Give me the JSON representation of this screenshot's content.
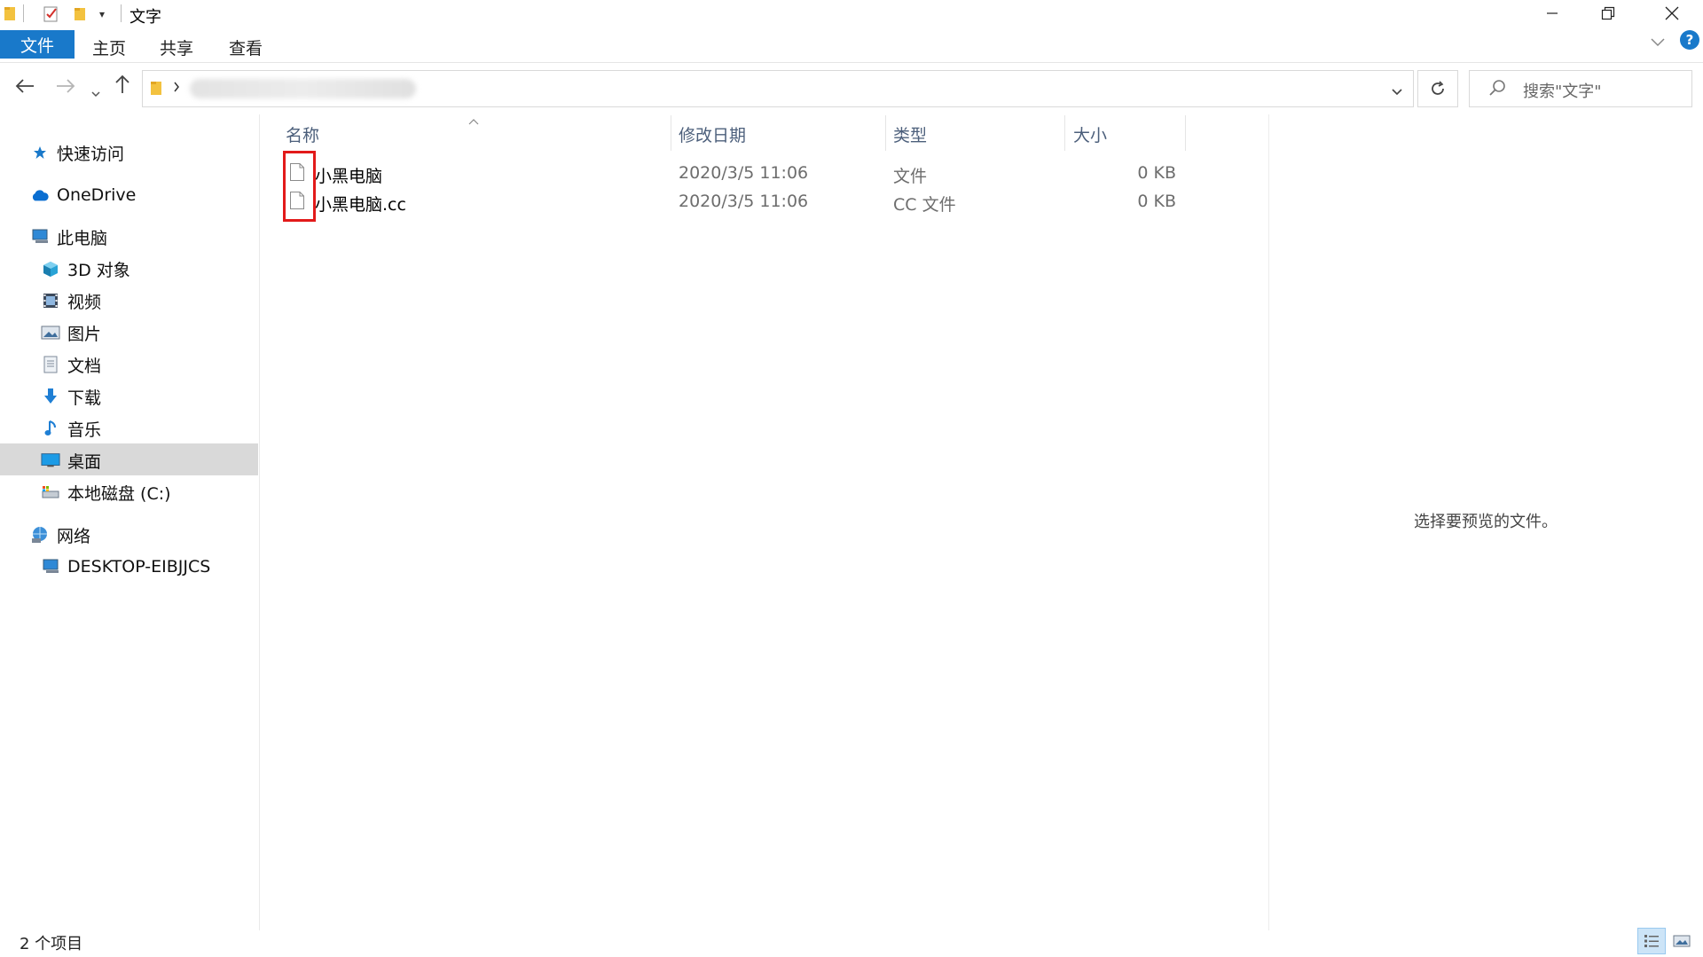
{
  "window": {
    "title": "文字",
    "quick_access_icons": [
      "folder-icon",
      "properties-checkmark-icon",
      "new-folder-icon",
      "customize-dropdown-icon"
    ],
    "controls": [
      "minimize",
      "restore",
      "close"
    ]
  },
  "ribbon": {
    "tabs": [
      {
        "label": "文件",
        "active": true
      },
      {
        "label": "主页"
      },
      {
        "label": "共享"
      },
      {
        "label": "查看"
      }
    ],
    "help": "?"
  },
  "address_bar": {
    "path": "",
    "search_placeholder": "搜索\"文字\""
  },
  "nav_pane": {
    "items": [
      {
        "label": "快速访问",
        "icon": "star-icon"
      },
      {
        "label": "OneDrive",
        "icon": "cloud-icon"
      },
      {
        "label": "此电脑",
        "icon": "computer-icon"
      },
      {
        "label": "3D 对象",
        "icon": "cube-3d-icon"
      },
      {
        "label": "视频",
        "icon": "video-icon"
      },
      {
        "label": "图片",
        "icon": "picture-icon"
      },
      {
        "label": "文档",
        "icon": "document-icon"
      },
      {
        "label": "下载",
        "icon": "download-arrow-icon"
      },
      {
        "label": "音乐",
        "icon": "music-note-icon"
      },
      {
        "label": "桌面",
        "icon": "desktop-icon",
        "selected": true
      },
      {
        "label": "本地磁盘 (C:)",
        "icon": "drive-icon"
      },
      {
        "label": "网络",
        "icon": "network-icon"
      },
      {
        "label": "DESKTOP-EIBJJCS",
        "icon": "computer-icon"
      }
    ]
  },
  "file_list": {
    "columns": [
      "名称",
      "修改日期",
      "类型",
      "大小"
    ],
    "sort_column": "名称",
    "rows": [
      {
        "name": "小黑电脑",
        "modified": "2020/3/5 11:06",
        "type": "文件",
        "size": "0 KB"
      },
      {
        "name": "小黑电脑.cc",
        "modified": "2020/3/5 11:06",
        "type": "CC 文件",
        "size": "0 KB"
      }
    ],
    "highlight_color": "#e21a1a"
  },
  "preview_pane": {
    "message": "选择要预览的文件。"
  },
  "status_bar": {
    "item_count": "2 个项目"
  },
  "colors": {
    "accent": "#1979ca",
    "selection": "#d9d9d9",
    "header_text": "#4c5f7b"
  }
}
